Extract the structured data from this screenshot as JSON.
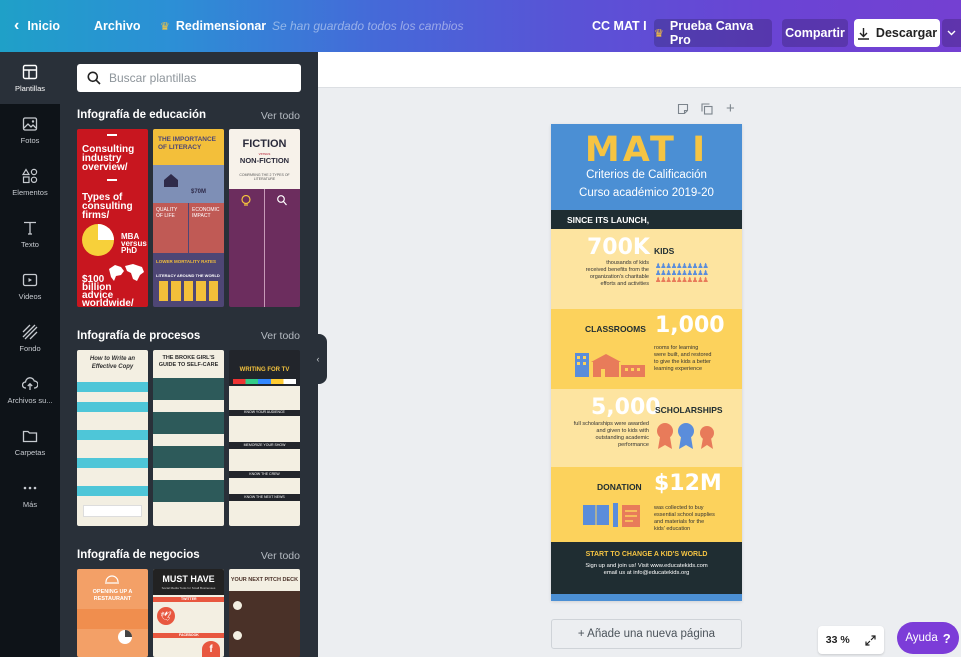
{
  "topbar": {
    "back_label": "Inicio",
    "file_label": "Archivo",
    "resize_label": "Redimensionar",
    "saved_status": "Se han guardado todos los cambios",
    "doc_title": "CC MAT I",
    "pro_label": "Prueba Canva Pro",
    "share_label": "Compartir",
    "download_label": "Descargar"
  },
  "rail": {
    "items": [
      {
        "label": "Plantillas",
        "icon": "layout-icon"
      },
      {
        "label": "Fotos",
        "icon": "photo-icon"
      },
      {
        "label": "Elementos",
        "icon": "shapes-icon"
      },
      {
        "label": "Texto",
        "icon": "text-icon"
      },
      {
        "label": "Videos",
        "icon": "video-icon"
      },
      {
        "label": "Fondo",
        "icon": "background-icon"
      },
      {
        "label": "Archivos su...",
        "icon": "upload-icon"
      },
      {
        "label": "Carpetas",
        "icon": "folder-icon"
      },
      {
        "label": "Más",
        "icon": "more-icon"
      }
    ]
  },
  "panel": {
    "search_placeholder": "Buscar plantillas",
    "sections": [
      {
        "title": "Infografía de educación",
        "link": "Ver todo"
      },
      {
        "title": "Infografía de procesos",
        "link": "Ver todo"
      },
      {
        "title": "Infografía de negocios",
        "link": "Ver todo"
      }
    ],
    "edu_thumbs": {
      "red": {
        "l1": "Consulting",
        "l2": "industry",
        "l3": "overview/",
        "l4": "Types of",
        "l5": "consulting",
        "l6": "firms/",
        "l7": "MBA",
        "l8": "versus",
        "l9": "PhD",
        "l10": "$100",
        "l11": "billion",
        "l12": "advice",
        "l13": "worldwide/"
      },
      "literacy": {
        "title1": "THE IMPORTANCE",
        "title2": "OF LITERACY",
        "stat": "$70M",
        "q1": "QUALITY",
        "q2": "OF LIFE",
        "q3": "ECONOMIC",
        "q4": "IMPACT",
        "q5": "LOWER MORTALITY RATES",
        "q6": "LITERACY AROUND THE WORLD"
      },
      "fiction": {
        "t1": "FICTION",
        "t2": "versus",
        "t3": "NON-FICTION",
        "t4": "COMPARING THE 2 TYPES OF LITERATURE"
      }
    },
    "proc_thumbs": {
      "a": {
        "t1": "How to Write an",
        "t2": "Effective Copy"
      },
      "b": {
        "t1": "THE BROKE GIRL'S",
        "t2": "GUIDE TO SELF-CARE"
      },
      "c": {
        "t1": "WRITING FOR TV",
        "t2": "KNOW YOUR AUDIENCE",
        "t3": "MEMORIZE YOUR SHOW",
        "t4": "KNOW THE CREW",
        "t5": "KNOW THE NEXT NEWS"
      }
    },
    "biz_thumbs": {
      "a": {
        "t1": "OPENING UP A",
        "t2": "RESTAURANT"
      },
      "b": {
        "t1": "MUST HAVE",
        "t2": "Social Media Tools for Small Businesses",
        "t3": "TWITTER",
        "t4": "FACEBOOK"
      },
      "c": {
        "t1": "YOUR NEXT PITCH DECK"
      }
    }
  },
  "design": {
    "title": "MAT I",
    "subtitle1": "Criterios de Calificación",
    "subtitle2": "Curso académico 2019-20",
    "since": "SINCE ITS LAUNCH,",
    "kids": {
      "num": "700K",
      "label": "KIDS",
      "l1": "thousands of kids",
      "l2": "received benefits from the",
      "l3": "organization's charitable",
      "l4": "efforts and activities"
    },
    "classrooms": {
      "label": "CLASSROOMS",
      "num": "1,000",
      "l1": "rooms for learning",
      "l2": "were built, and restored",
      "l3": "to give the kids a better",
      "l4": "learning experience"
    },
    "scholarships": {
      "num": "5,000",
      "label": "SCHOLARSHIPS",
      "l1": "full scholarships were awarded",
      "l2": "and given to kids with",
      "l3": "outstanding academic",
      "l4": "performance"
    },
    "donation": {
      "label": "DONATION",
      "num": "$12M",
      "l1": "was collected to buy",
      "l2": "essential school supplies",
      "l3": "and materials for the",
      "l4": "kids' education"
    },
    "footer1": "START TO CHANGE A KID'S WORLD",
    "footer2": "Sign up and join us! Visit www.educatekids.com",
    "footer3": "email us at info@educatekids.org"
  },
  "canvas": {
    "add_page": "+ Añade una nueva página",
    "zoom": "33 %",
    "help_label": "Ayuda",
    "help_mark": "?"
  },
  "colors": {
    "accent_purple": "#7c3cd8",
    "panel_bg": "#293039",
    "rail_bg": "#0e1318",
    "design_blue": "#4b8fd4",
    "design_yellow": "#f5c443",
    "design_dark": "#1f2d32"
  }
}
